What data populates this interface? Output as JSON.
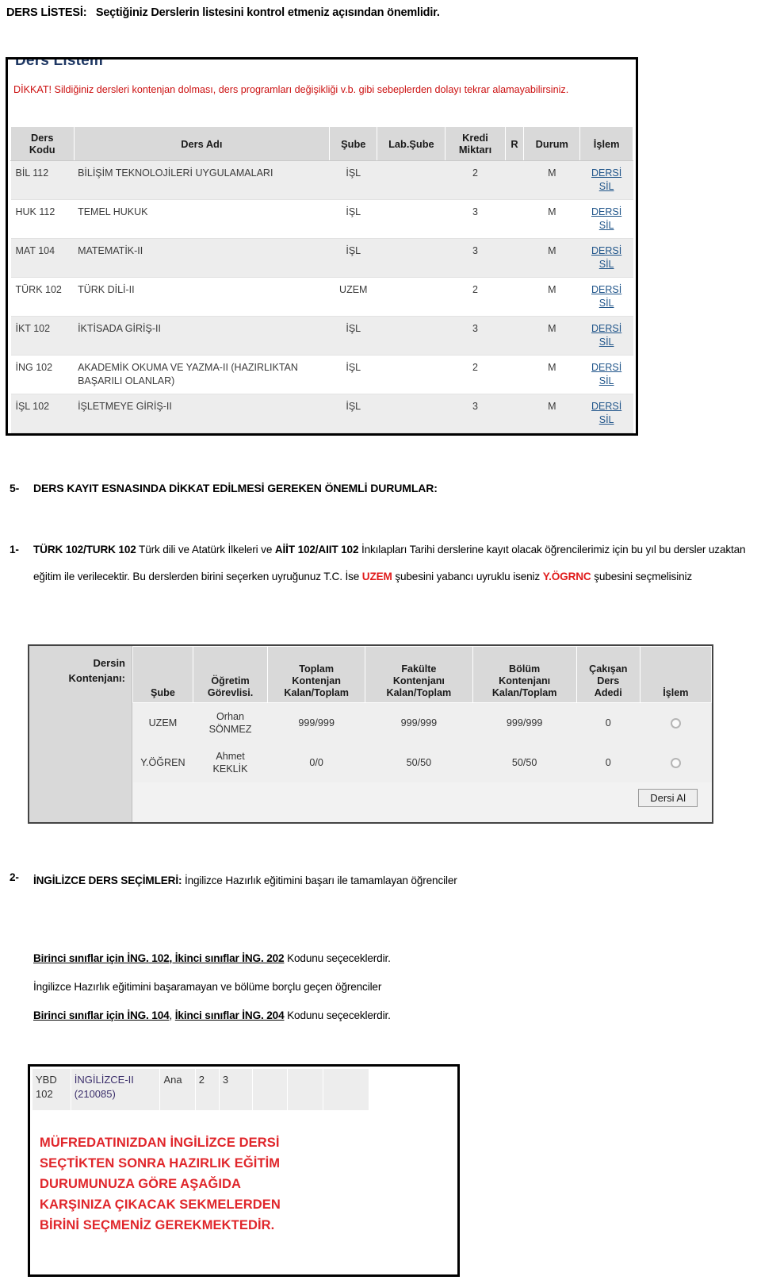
{
  "doc": {
    "heading_lead": "DERS LİSTESİ:",
    "heading_rest": "Seçtiğiniz Derslerin listesini kontrol etmeniz açısından önemlidir."
  },
  "ders_listem": {
    "title": "Ders Listem",
    "warning": "DİKKAT! Sildiğiniz dersleri kontenjan dolması, ders programları değişikliği v.b. gibi sebeplerden dolayı tekrar alamayabilirsiniz.",
    "columns": [
      "Ders Kodu",
      "Ders Adı",
      "Şube",
      "Lab.Şube",
      "Kredi Miktarı",
      "R",
      "Durum",
      "İşlem"
    ],
    "columns_multiline": {
      "kodu_l1": "Ders",
      "kodu_l2": "Kodu",
      "kredi_l1": "Kredi",
      "kredi_l2": "Miktarı"
    },
    "action_label_l1": "DERSİ",
    "action_label_l2": "SİL",
    "rows": [
      {
        "kod": "BİL 112",
        "ad": "BİLİŞİM TEKNOLOJİLERİ UYGULAMALARI",
        "sube": "İŞL",
        "lab": "",
        "kredi": "2",
        "r": "",
        "durum": "M"
      },
      {
        "kod": "HUK 112",
        "ad": "TEMEL HUKUK",
        "sube": "İŞL",
        "lab": "",
        "kredi": "3",
        "r": "",
        "durum": "M"
      },
      {
        "kod": "MAT 104",
        "ad": "MATEMATİK-II",
        "sube": "İŞL",
        "lab": "",
        "kredi": "3",
        "r": "",
        "durum": "M"
      },
      {
        "kod": "TÜRK 102",
        "ad": "TÜRK DİLİ-II",
        "sube": "UZEM",
        "lab": "",
        "kredi": "2",
        "r": "",
        "durum": "M"
      },
      {
        "kod": "İKT 102",
        "ad": "İKTİSADA GİRİŞ-II",
        "sube": "İŞL",
        "lab": "",
        "kredi": "3",
        "r": "",
        "durum": "M"
      },
      {
        "kod": "İNG 102",
        "ad": "AKADEMİK OKUMA VE YAZMA-II (HAZIRLIKTAN BAŞARILI OLANLAR)",
        "sube": "İŞL",
        "lab": "",
        "kredi": "2",
        "r": "",
        "durum": "M"
      },
      {
        "kod": "İŞL 102",
        "ad": "İŞLETMEYE GİRİŞ-II",
        "sube": "İŞL",
        "lab": "",
        "kredi": "3",
        "r": "",
        "durum": "M"
      }
    ]
  },
  "section5": {
    "number": "5-",
    "title": "DERS KAYIT ESNASINDA DİKKAT EDİLMESİ GEREKEN ÖNEMLİ DURUMLAR:"
  },
  "item1": {
    "number": "1-",
    "b1": "TÜRK 102/TURK 102",
    "t1": " Türk dili ve Atatürk İlkeleri ve ",
    "b2": "AİİT 102/AIIT 102",
    "t2": " İnkılapları Tarihi derslerine kayıt olacak öğrencilerimiz için bu yıl bu dersler uzaktan eğitim ile verilecektir. Bu derslerden birini seçerken uyruğunuz T.C. İse ",
    "r1": "UZEM",
    "t3": " şubesini yabancı uyruklu iseniz ",
    "r2": "Y.ÖGRNC",
    "t4": " şubesini seçmelisiniz"
  },
  "kontenjan": {
    "left_label_l1": "Dersin",
    "left_label_l2": "Kontenjanı:",
    "columns": {
      "sube": "Şube",
      "ogretim_l1": "Öğretim",
      "ogretim_l2": "Görevlisi.",
      "toplam_l1": "Toplam",
      "toplam_l2": "Kontenjan",
      "toplam_l3": "Kalan/Toplam",
      "fakulte_l1": "Fakülte",
      "fakulte_l2": "Kontenjanı",
      "fakulte_l3": "Kalan/Toplam",
      "bolum_l1": "Bölüm",
      "bolum_l2": "Kontenjanı",
      "bolum_l3": "Kalan/Toplam",
      "cakisan_l1": "Çakışan",
      "cakisan_l2": "Ders",
      "cakisan_l3": "Adedi",
      "islem": "İşlem"
    },
    "rows": [
      {
        "sube": "UZEM",
        "ogretim_l1": "Orhan",
        "ogretim_l2": "SÖNMEZ",
        "toplam": "999/999",
        "fakulte": "999/999",
        "bolum": "999/999",
        "cakisan": "0"
      },
      {
        "sube": "Y.ÖĞREN",
        "ogretim_l1": "Ahmet",
        "ogretim_l2": "KEKLİK",
        "toplam": "0/0",
        "fakulte": "50/50",
        "bolum": "50/50",
        "cakisan": "0"
      }
    ],
    "button_label": "Dersi Al"
  },
  "item2": {
    "number": "2-",
    "b1": "İNGİLİZCE DERS SEÇİMLERİ:",
    "t1": " İngilizce Hazırlık eğitimini başarı ile tamamlayan öğrenciler",
    "line1_u1": "Birinci sınıflar için İNG.",
    "line1_u2": " 102, İkinci sınıflar İNG. 202",
    "line1_rest": " Kodunu seçeceklerdir.",
    "line2": "İngilizce Hazırlık eğitimini başaramayan ve bölüme borçlu geçen öğrenciler",
    "line3_u1": "Birinci sınıflar için İNG. 104",
    "line3_sep": ", ",
    "line3_u2": "İkinci sınıflar İNG. 204",
    "line3_rest": " Kodunu seçeceklerdir."
  },
  "ybd": {
    "kod_l1": "YBD",
    "kod_l2": "102",
    "ad_l1": "İNGİLİZCE-II",
    "ad_l2": "(210085)",
    "tip": "Ana",
    "v1": "2",
    "v2": "3",
    "v3": "",
    "v4": "",
    "v5": "",
    "notice_l1": "MÜFREDATINIZDAN İNGİLİZCE DERSİ",
    "notice_l2": "SEÇTİKTEN SONRA HAZIRLIK EĞİTİM",
    "notice_l3": "DURUMUNUZA GÖRE AŞAĞIDA",
    "notice_l4": "KARŞINIZA ÇIKACAK SEKMELERDEN",
    "notice_l5": "BİRİNİ SEÇMENİZ GEREKMEKTEDİR."
  },
  "colors": {
    "title_blue": "#1f3864",
    "warning_red": "#cc1111",
    "link_blue": "#20558a",
    "notice_red": "#e0262b",
    "accent_red": "#e01b1b",
    "header_gray": "#d9d9d9"
  }
}
